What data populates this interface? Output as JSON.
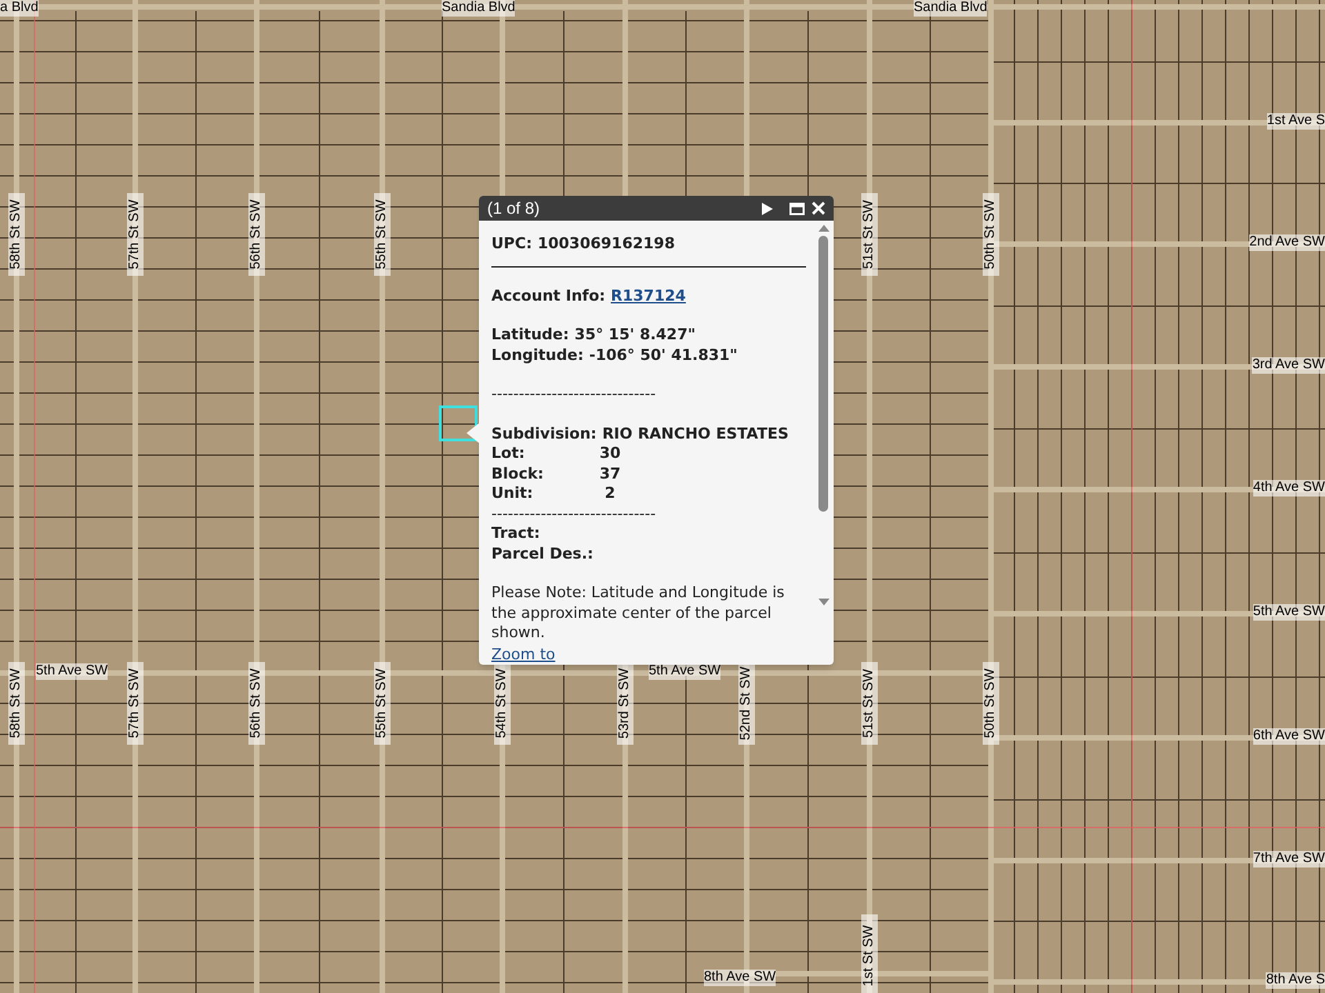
{
  "map": {
    "labels": [
      {
        "text": "a Blvd",
        "kind": "horizontal"
      },
      {
        "text": "Sandia Blvd",
        "kind": "horizontal"
      },
      {
        "text": "Sandia Blvd",
        "kind": "horizontal"
      },
      {
        "text": "1st Ave S",
        "kind": "horizontal"
      },
      {
        "text": "2nd Ave SW",
        "kind": "horizontal"
      },
      {
        "text": "3rd Ave SW",
        "kind": "horizontal"
      },
      {
        "text": "4th Ave SW",
        "kind": "horizontal"
      },
      {
        "text": "5th Ave SW",
        "kind": "horizontal"
      },
      {
        "text": "6th Ave SW",
        "kind": "horizontal"
      },
      {
        "text": "7th Ave SW",
        "kind": "horizontal"
      },
      {
        "text": "8th Ave S",
        "kind": "horizontal"
      },
      {
        "text": "5th Ave SW",
        "kind": "horizontal"
      },
      {
        "text": "5th Ave SW",
        "kind": "horizontal"
      },
      {
        "text": "8th Ave SW",
        "kind": "horizontal"
      },
      {
        "text": "58th St SW",
        "kind": "vertical"
      },
      {
        "text": "57th St SW",
        "kind": "vertical"
      },
      {
        "text": "56th St SW",
        "kind": "vertical"
      },
      {
        "text": "55th St SW",
        "kind": "vertical"
      },
      {
        "text": "51st St SW",
        "kind": "vertical"
      },
      {
        "text": "50th St SW",
        "kind": "vertical"
      },
      {
        "text": "58th St SW",
        "kind": "vertical"
      },
      {
        "text": "57th St SW",
        "kind": "vertical"
      },
      {
        "text": "56th St SW",
        "kind": "vertical"
      },
      {
        "text": "55th St SW",
        "kind": "vertical"
      },
      {
        "text": "54th St SW",
        "kind": "vertical"
      },
      {
        "text": "53rd St SW",
        "kind": "vertical"
      },
      {
        "text": "52nd St SW",
        "kind": "vertical"
      },
      {
        "text": "51st St SW",
        "kind": "vertical"
      },
      {
        "text": "50th St SW",
        "kind": "vertical"
      },
      {
        "text": "1st St SW",
        "kind": "vertical"
      }
    ]
  },
  "popup": {
    "title": "(1 of 8)",
    "blocks": [
      [
        {
          "kind": "field",
          "label": "UPC:",
          "value": "1003069162198"
        },
        {
          "kind": "rule"
        }
      ],
      [
        {
          "kind": "link_field",
          "label": "Account Info:",
          "value": "R137124"
        }
      ],
      [
        {
          "kind": "field",
          "label": "Latitude:",
          "value": "35° 15' 8.427\""
        },
        {
          "kind": "field",
          "label": "Longitude:",
          "value": "-106° 50' 41.831\""
        }
      ],
      [
        {
          "kind": "dashes",
          "text": "------------------------------"
        }
      ],
      [
        {
          "kind": "field",
          "label": "Subdivision:",
          "value": "RIO RANCHO ESTATES"
        },
        {
          "kind": "column_field",
          "label": "Lot:",
          "value": "30"
        },
        {
          "kind": "column_field",
          "label": "Block:",
          "value": "37"
        },
        {
          "kind": "column_field",
          "label": "Unit:",
          "value": "2"
        },
        {
          "kind": "dashes",
          "text": "------------------------------"
        },
        {
          "kind": "label",
          "label": "Tract:"
        },
        {
          "kind": "label",
          "label": "Parcel Des.:"
        }
      ],
      [
        {
          "kind": "note",
          "text": "Please Note: Latitude and Longitude is the approximate center of the parcel shown."
        }
      ]
    ],
    "footer_link": "Zoom to"
  }
}
